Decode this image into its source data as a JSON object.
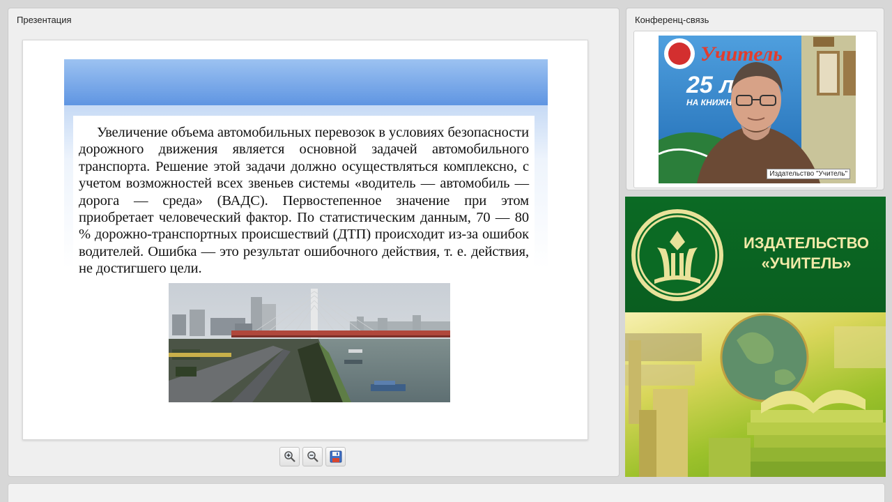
{
  "presentation": {
    "title": "Презентация",
    "slide_text": "Увеличение объема автомобильных перевозок в условиях безопасности дорожного движения является основной задачей автомобильного транспорта. Решение этой задачи должно осуществляться комплексно, с учетом возможностей всех звеньев системы «водитель — автомобиль — дорога — среда» (ВАДС). Первостепенное значение при этом приобретает человеческий фактор. По статистическим данным, 70 — 80 % дорожно-транспортных происшествий (ДТП) происходит из-за ошибок водителей. Ошибка — это результат ошибочного действия, т. е. действия, не достигшего цели."
  },
  "toolbar": {
    "zoom_in_icon": "zoom-in-icon",
    "zoom_out_icon": "zoom-out-icon",
    "save_icon": "save-icon"
  },
  "conference": {
    "title": "Конференц-связь",
    "video_label": "Издательство \"Учитель\"",
    "backdrop_brand": "Учитель",
    "backdrop_years": "25 л",
    "backdrop_caption": "НА КНИЖН"
  },
  "brand": {
    "name_line1": "ИЗДАТЕЛЬСТВО",
    "name_line2": "«УЧИТЕЛЬ»"
  },
  "colors": {
    "brand_green": "#0b6a24",
    "brand_text": "#f1e9a8",
    "slide_header_blue": "#5f95e2"
  }
}
